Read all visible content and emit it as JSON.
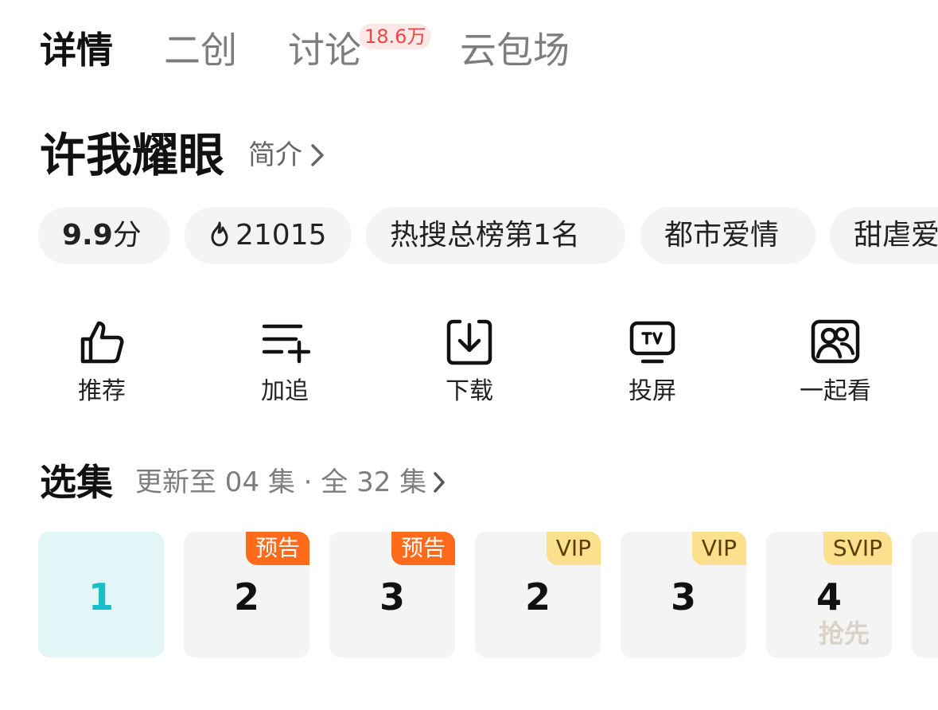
{
  "tabs": [
    {
      "label": "详情",
      "active": true
    },
    {
      "label": "二创",
      "active": false
    },
    {
      "label": "讨论",
      "active": false,
      "badge": "18.6万"
    },
    {
      "label": "云包场",
      "active": false
    }
  ],
  "title": "许我耀眼",
  "intro_link": "简介",
  "chips": [
    {
      "score": "9.9",
      "unit": "分"
    },
    {
      "icon": "flame-icon",
      "label": "21015"
    },
    {
      "label": "热搜总榜第1名"
    },
    {
      "label": "都市爱情"
    },
    {
      "label": "甜虐爱"
    }
  ],
  "actions": [
    {
      "icon": "thumbs-up-icon",
      "label": "推荐"
    },
    {
      "icon": "add-to-list-icon",
      "label": "加追"
    },
    {
      "icon": "download-icon",
      "label": "下载"
    },
    {
      "icon": "tv-cast-icon",
      "label": "投屏"
    },
    {
      "icon": "watch-together-icon",
      "label": "一起看"
    }
  ],
  "episodes": {
    "title": "选集",
    "meta": "更新至 04 集 · 全 32 集",
    "items": [
      {
        "number": "1",
        "selected": true
      },
      {
        "number": "2",
        "tag": "预告"
      },
      {
        "number": "3",
        "tag": "预告"
      },
      {
        "number": "2",
        "tag": "VIP"
      },
      {
        "number": "3",
        "tag": "VIP"
      },
      {
        "number": "4",
        "tag": "SVIP",
        "sub": "抢先"
      }
    ]
  },
  "colors": {
    "accent": "#19bfc6",
    "preview_tag": "#ff6b1a",
    "vip_tag": "#fbe18d",
    "badge_red": "#f04545"
  }
}
